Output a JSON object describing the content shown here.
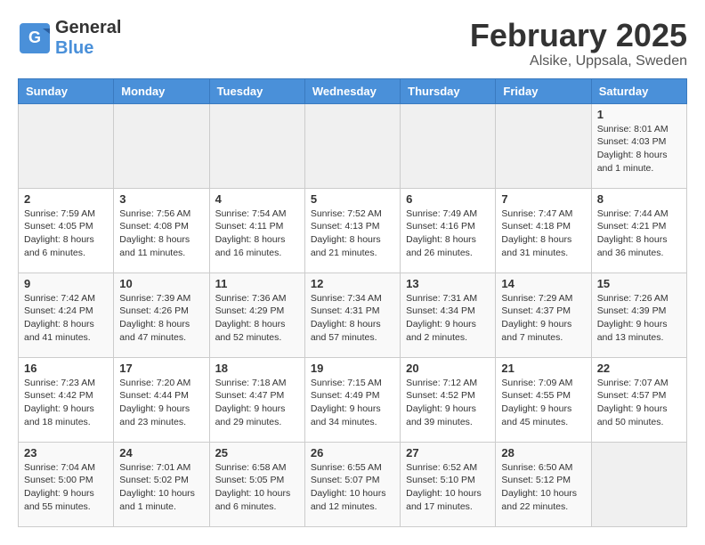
{
  "header": {
    "logo_general": "General",
    "logo_blue": "Blue",
    "title": "February 2025",
    "subtitle": "Alsike, Uppsala, Sweden"
  },
  "weekdays": [
    "Sunday",
    "Monday",
    "Tuesday",
    "Wednesday",
    "Thursday",
    "Friday",
    "Saturday"
  ],
  "weeks": [
    [
      {
        "day": "",
        "info": ""
      },
      {
        "day": "",
        "info": ""
      },
      {
        "day": "",
        "info": ""
      },
      {
        "day": "",
        "info": ""
      },
      {
        "day": "",
        "info": ""
      },
      {
        "day": "",
        "info": ""
      },
      {
        "day": "1",
        "info": "Sunrise: 8:01 AM\nSunset: 4:03 PM\nDaylight: 8 hours and 1 minute."
      }
    ],
    [
      {
        "day": "2",
        "info": "Sunrise: 7:59 AM\nSunset: 4:05 PM\nDaylight: 8 hours and 6 minutes."
      },
      {
        "day": "3",
        "info": "Sunrise: 7:56 AM\nSunset: 4:08 PM\nDaylight: 8 hours and 11 minutes."
      },
      {
        "day": "4",
        "info": "Sunrise: 7:54 AM\nSunset: 4:11 PM\nDaylight: 8 hours and 16 minutes."
      },
      {
        "day": "5",
        "info": "Sunrise: 7:52 AM\nSunset: 4:13 PM\nDaylight: 8 hours and 21 minutes."
      },
      {
        "day": "6",
        "info": "Sunrise: 7:49 AM\nSunset: 4:16 PM\nDaylight: 8 hours and 26 minutes."
      },
      {
        "day": "7",
        "info": "Sunrise: 7:47 AM\nSunset: 4:18 PM\nDaylight: 8 hours and 31 minutes."
      },
      {
        "day": "8",
        "info": "Sunrise: 7:44 AM\nSunset: 4:21 PM\nDaylight: 8 hours and 36 minutes."
      }
    ],
    [
      {
        "day": "9",
        "info": "Sunrise: 7:42 AM\nSunset: 4:24 PM\nDaylight: 8 hours and 41 minutes."
      },
      {
        "day": "10",
        "info": "Sunrise: 7:39 AM\nSunset: 4:26 PM\nDaylight: 8 hours and 47 minutes."
      },
      {
        "day": "11",
        "info": "Sunrise: 7:36 AM\nSunset: 4:29 PM\nDaylight: 8 hours and 52 minutes."
      },
      {
        "day": "12",
        "info": "Sunrise: 7:34 AM\nSunset: 4:31 PM\nDaylight: 8 hours and 57 minutes."
      },
      {
        "day": "13",
        "info": "Sunrise: 7:31 AM\nSunset: 4:34 PM\nDaylight: 9 hours and 2 minutes."
      },
      {
        "day": "14",
        "info": "Sunrise: 7:29 AM\nSunset: 4:37 PM\nDaylight: 9 hours and 7 minutes."
      },
      {
        "day": "15",
        "info": "Sunrise: 7:26 AM\nSunset: 4:39 PM\nDaylight: 9 hours and 13 minutes."
      }
    ],
    [
      {
        "day": "16",
        "info": "Sunrise: 7:23 AM\nSunset: 4:42 PM\nDaylight: 9 hours and 18 minutes."
      },
      {
        "day": "17",
        "info": "Sunrise: 7:20 AM\nSunset: 4:44 PM\nDaylight: 9 hours and 23 minutes."
      },
      {
        "day": "18",
        "info": "Sunrise: 7:18 AM\nSunset: 4:47 PM\nDaylight: 9 hours and 29 minutes."
      },
      {
        "day": "19",
        "info": "Sunrise: 7:15 AM\nSunset: 4:49 PM\nDaylight: 9 hours and 34 minutes."
      },
      {
        "day": "20",
        "info": "Sunrise: 7:12 AM\nSunset: 4:52 PM\nDaylight: 9 hours and 39 minutes."
      },
      {
        "day": "21",
        "info": "Sunrise: 7:09 AM\nSunset: 4:55 PM\nDaylight: 9 hours and 45 minutes."
      },
      {
        "day": "22",
        "info": "Sunrise: 7:07 AM\nSunset: 4:57 PM\nDaylight: 9 hours and 50 minutes."
      }
    ],
    [
      {
        "day": "23",
        "info": "Sunrise: 7:04 AM\nSunset: 5:00 PM\nDaylight: 9 hours and 55 minutes."
      },
      {
        "day": "24",
        "info": "Sunrise: 7:01 AM\nSunset: 5:02 PM\nDaylight: 10 hours and 1 minute."
      },
      {
        "day": "25",
        "info": "Sunrise: 6:58 AM\nSunset: 5:05 PM\nDaylight: 10 hours and 6 minutes."
      },
      {
        "day": "26",
        "info": "Sunrise: 6:55 AM\nSunset: 5:07 PM\nDaylight: 10 hours and 12 minutes."
      },
      {
        "day": "27",
        "info": "Sunrise: 6:52 AM\nSunset: 5:10 PM\nDaylight: 10 hours and 17 minutes."
      },
      {
        "day": "28",
        "info": "Sunrise: 6:50 AM\nSunset: 5:12 PM\nDaylight: 10 hours and 22 minutes."
      },
      {
        "day": "",
        "info": ""
      }
    ]
  ]
}
